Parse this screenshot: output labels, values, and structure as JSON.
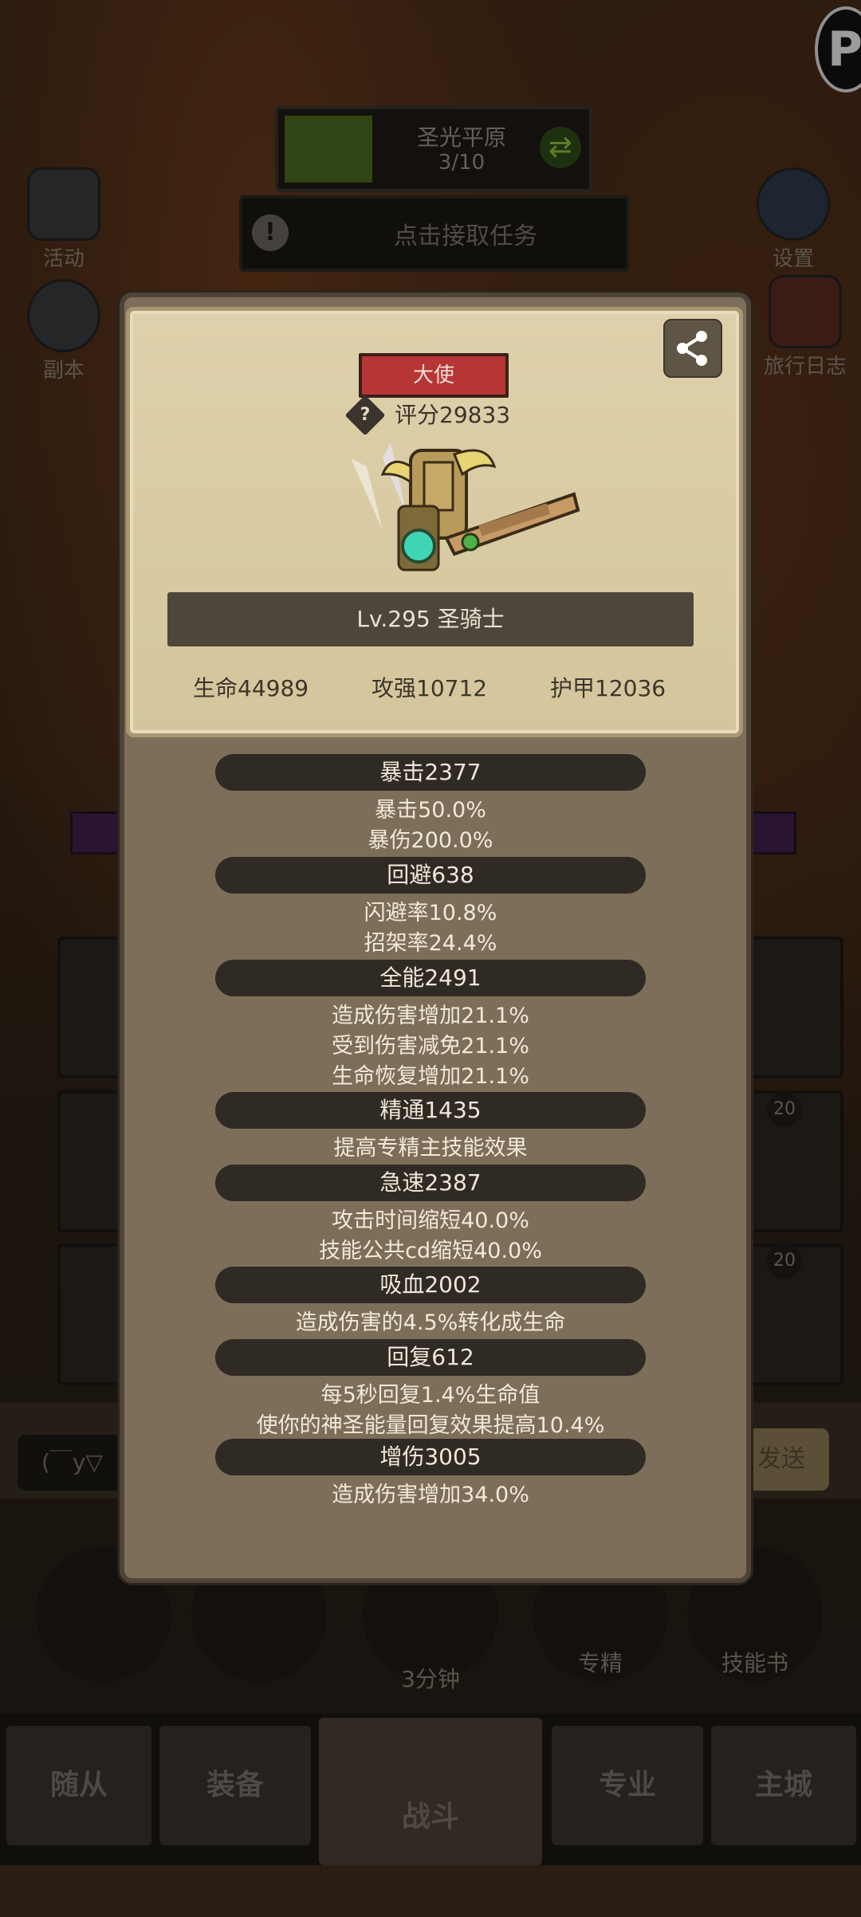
{
  "background": {
    "zone": {
      "name": "圣光平原",
      "progress": "3/10"
    },
    "task": {
      "label": "点击接取任务"
    },
    "left_buttons": [
      {
        "label": "活动",
        "icon": "activity-icon"
      },
      {
        "label": "副本",
        "icon": "dungeon-icon"
      }
    ],
    "right_buttons": [
      {
        "label": "设置",
        "icon": "gear-icon"
      },
      {
        "label": "旅行日志",
        "icon": "journal-icon"
      }
    ],
    "chat": {
      "input_value": "(￣y▽",
      "send_label": "发送"
    },
    "slot_badges": [
      "20",
      "20"
    ],
    "bottom_items": [
      {
        "label": "",
        "icon": "potion-icon"
      },
      {
        "label": "",
        "icon": "bread-icon"
      },
      {
        "label": "3分钟",
        "icon": "chest-icon"
      },
      {
        "label": "专精",
        "icon": "specialization-icon"
      },
      {
        "label": "技能书",
        "icon": "skill-book-icon"
      }
    ],
    "tabs": [
      {
        "label": "随从"
      },
      {
        "label": "装备"
      },
      {
        "label": "战斗",
        "active": true
      },
      {
        "label": "专业"
      },
      {
        "label": "主城"
      }
    ]
  },
  "profile": {
    "title_badge": "大使",
    "score": "评分29833",
    "level_class": "Lv.295 圣骑士",
    "stats": {
      "hp": "生命44989",
      "attack": "攻强10712",
      "armor": "护甲12036"
    }
  },
  "sections": [
    {
      "header": "暴击2377",
      "lines": [
        "暴击50.0%",
        "暴伤200.0%"
      ]
    },
    {
      "header": "回避638",
      "lines": [
        "闪避率10.8%",
        "招架率24.4%"
      ]
    },
    {
      "header": "全能2491",
      "lines": [
        "造成伤害增加21.1%",
        "受到伤害减免21.1%",
        "生命恢复增加21.1%"
      ]
    },
    {
      "header": "精通1435",
      "lines": [
        "提高专精主技能效果"
      ]
    },
    {
      "header": "急速2387",
      "lines": [
        "攻击时间缩短40.0%",
        "技能公共cd缩短40.0%"
      ]
    },
    {
      "header": "吸血2002",
      "lines": [
        "造成伤害的4.5%转化成生命"
      ]
    },
    {
      "header": "回复612",
      "lines": [
        "每5秒回复1.4%生命值",
        "使你的神圣能量回复效果提高10.4%"
      ]
    },
    {
      "header": "增伤3005",
      "lines": [
        "造成伤害增加34.0%"
      ]
    }
  ],
  "colors": {
    "title_badge": "#b73535",
    "panel": "#7d6e59",
    "parchment": "#d9caa3",
    "section_bar": "#2f2a24"
  }
}
